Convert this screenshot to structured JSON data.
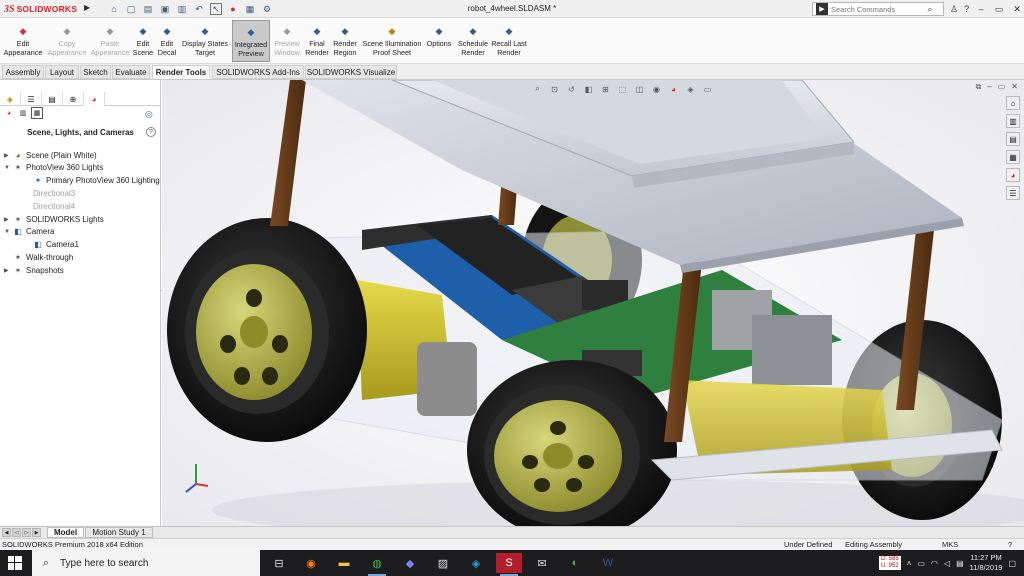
{
  "window": {
    "logo_text": "SOLIDWORKS",
    "document_title": "robot_4wheel.SLDASM *",
    "search_placeholder": "Search Commands"
  },
  "command_manager": [
    {
      "label": "Edit\nAppearance",
      "icon": "appearance-icon",
      "enabled": true
    },
    {
      "label": "Copy\nAppearance",
      "icon": "copy-appearance-icon",
      "enabled": false
    },
    {
      "label": "Paste\nAppearance",
      "icon": "paste-appearance-icon",
      "enabled": false
    },
    {
      "label": "Edit\nScene",
      "icon": "scene-icon",
      "enabled": true
    },
    {
      "label": "Edit\nDecal",
      "icon": "decal-icon",
      "enabled": true
    },
    {
      "label": "Display States\nTarget",
      "icon": "display-states-icon",
      "enabled": true
    },
    {
      "label": "Integrated\nPreview",
      "icon": "integrated-preview-icon",
      "enabled": true,
      "active": true
    },
    {
      "label": "Preview\nWindow",
      "icon": "preview-window-icon",
      "enabled": false
    },
    {
      "label": "Final\nRender",
      "icon": "final-render-icon",
      "enabled": true
    },
    {
      "label": "Render\nRegion",
      "icon": "render-region-icon",
      "enabled": true
    },
    {
      "label": "Scene Illumination\nProof Sheet",
      "icon": "illumination-icon",
      "enabled": true
    },
    {
      "label": "Options",
      "icon": "options-icon",
      "enabled": true
    },
    {
      "label": "Schedule\nRender",
      "icon": "schedule-icon",
      "enabled": true
    },
    {
      "label": "Recall Last\nRender",
      "icon": "recall-icon",
      "enabled": true
    }
  ],
  "tabs": [
    {
      "label": "Assembly"
    },
    {
      "label": "Layout"
    },
    {
      "label": "Sketch"
    },
    {
      "label": "Evaluate"
    },
    {
      "label": "Render Tools",
      "active": true
    },
    {
      "label": "SOLIDWORKS Add-Ins"
    },
    {
      "label": "SOLIDWORKS Visualize"
    }
  ],
  "panel": {
    "title": "Scene, Lights, and Cameras",
    "tree": [
      {
        "label": "Scene (Plain White)",
        "arrow": "collapsed",
        "icon": "scene-icon"
      },
      {
        "label": "PhotoView 360 Lights",
        "arrow": "expanded",
        "icon": "lights-icon"
      },
      {
        "label": "Primary PhotoView 360 Lighting",
        "arrow": "",
        "icon": "primary-light-icon"
      },
      {
        "label": "Directional3",
        "arrow": "",
        "icon": "",
        "dim": true
      },
      {
        "label": "Directional4",
        "arrow": "",
        "icon": "",
        "dim": true
      },
      {
        "label": "SOLIDWORKS Lights",
        "arrow": "collapsed",
        "icon": "lights-icon"
      },
      {
        "label": "Camera",
        "arrow": "expanded",
        "icon": "camera-icon"
      },
      {
        "label": "Camera1",
        "arrow": "",
        "icon": "camera-icon"
      },
      {
        "label": "Walk-through",
        "arrow": "",
        "icon": "walkthrough-icon"
      },
      {
        "label": "Snapshots",
        "arrow": "collapsed",
        "icon": "snapshots-icon"
      }
    ]
  },
  "bottom_tabs": [
    {
      "label": "Model",
      "active": true
    },
    {
      "label": "Motion Study 1"
    }
  ],
  "status": {
    "edition": "SOLIDWORKS Premium 2018 x64 Edition",
    "state": "Under Defined",
    "mode": "Editing Assembly",
    "units": "MKS"
  },
  "taskbar": {
    "search_placeholder": "Type here to search",
    "time": "11:27 PM",
    "date": "11/8/2019",
    "counter_top": "D: 585",
    "counter_bottom": "U: 952"
  }
}
